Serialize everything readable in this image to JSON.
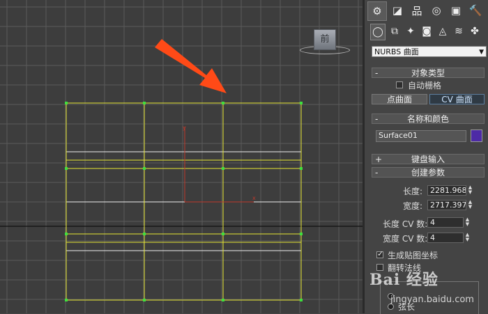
{
  "viewport": {
    "view_label": "前",
    "axis_x": "x",
    "axis_y": "y"
  },
  "command_panel": {
    "tabs": [
      {
        "name": "create",
        "icon": "⚙",
        "active": true
      },
      {
        "name": "modify",
        "icon": "◪"
      },
      {
        "name": "hierarchy",
        "icon": "品"
      },
      {
        "name": "motion",
        "icon": "◎"
      },
      {
        "name": "display",
        "icon": "▣"
      },
      {
        "name": "utilities",
        "icon": "🔨"
      }
    ],
    "categories": [
      {
        "name": "geometry",
        "icon": "◯",
        "active": true
      },
      {
        "name": "shapes",
        "icon": "⧉"
      },
      {
        "name": "lights",
        "icon": "✦"
      },
      {
        "name": "cameras",
        "icon": "◙"
      },
      {
        "name": "helpers",
        "icon": "◬"
      },
      {
        "name": "space-warps",
        "icon": "≋"
      },
      {
        "name": "systems",
        "icon": "✤"
      }
    ],
    "dropdown_value": "NURBS 曲面",
    "object_type": {
      "title": "对象类型",
      "auto_grid_label": "自动栅格",
      "buttons": [
        "点曲面",
        "CV 曲面"
      ],
      "active_button": "CV 曲面"
    },
    "name_color": {
      "title": "名称和颜色",
      "name_value": "Surface01",
      "color": "#4d2aa6"
    },
    "keyboard_entry": {
      "title": "键盘输入"
    },
    "create_params": {
      "title": "创建参数",
      "length_label": "长度:",
      "length_value": "2281.968m",
      "width_label": "宽度:",
      "width_value": "2717.397m",
      "length_cv_label": "长度 CV 数:",
      "length_cv_value": "4",
      "width_cv_label": "宽度 CV 数:",
      "width_cv_value": "4",
      "gen_mapping_label": "生成贴图坐标",
      "gen_mapping_checked": true,
      "flip_label": "翻转法线",
      "flip_checked": false,
      "chord_label": "弦长"
    }
  },
  "watermark": {
    "logo": "Bai 经验",
    "url": "jingyan.baidu.com"
  },
  "colors": {
    "viewport_bg": "#3d3d3d",
    "grid": "#5a5a5a",
    "surface": "#e6e632",
    "arrow": "#ff4a17"
  }
}
